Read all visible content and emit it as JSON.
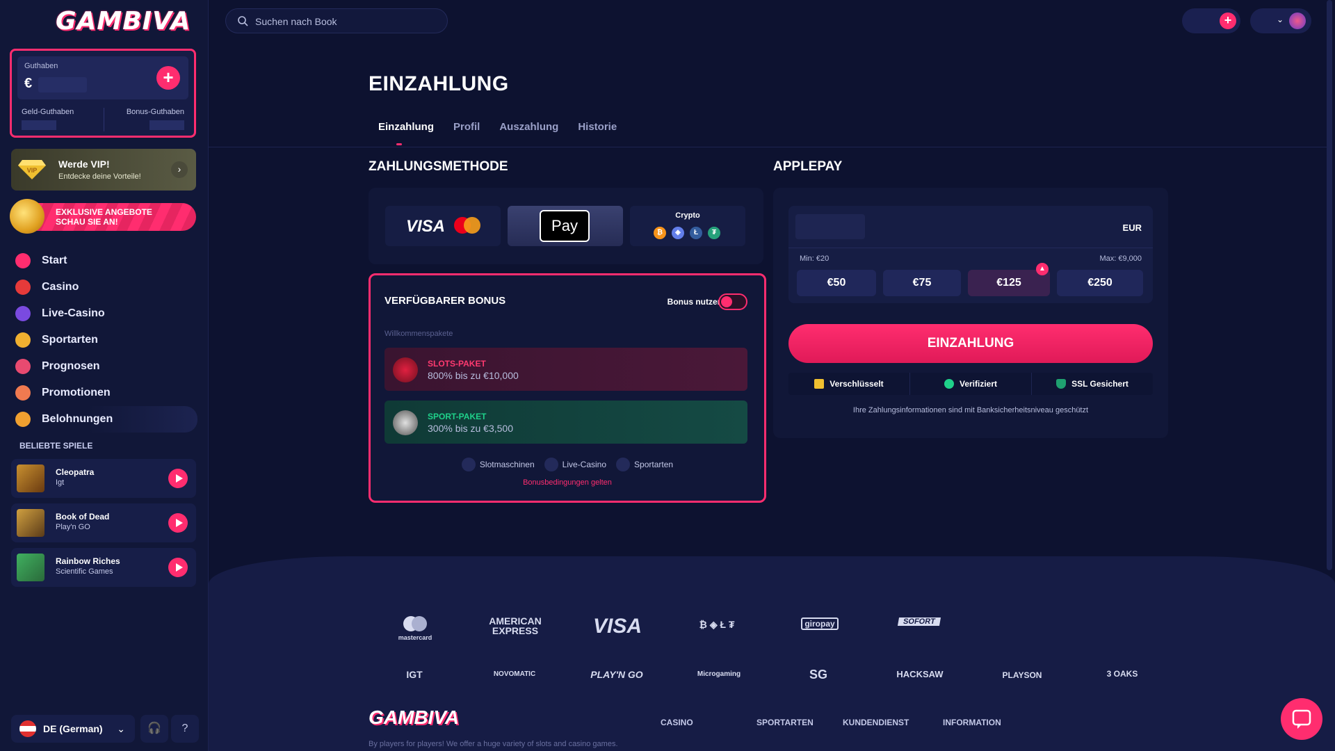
{
  "sidebar": {
    "logo": "GAMBIVA",
    "balance": {
      "label": "Guthaben",
      "currency": "€",
      "money_label": "Geld-Guthaben",
      "bonus_label": "Bonus-Guthaben"
    },
    "vip": {
      "title": "Werde VIP!",
      "subtitle": "Entdecke deine Vorteile!",
      "badge": "VIP"
    },
    "promo": {
      "line1": "EXKLUSIVE ANGEBOTE",
      "line2": "SCHAU SIE AN!"
    },
    "nav": [
      {
        "label": "Start",
        "icon": "swirl-icon",
        "color": "#ff2d6f"
      },
      {
        "label": "Casino",
        "icon": "cherry-icon",
        "color": "#e63a3a"
      },
      {
        "label": "Live-Casino",
        "icon": "chip-icon",
        "color": "#7a4ae0"
      },
      {
        "label": "Sportarten",
        "icon": "medal-icon",
        "color": "#f0b030"
      },
      {
        "label": "Prognosen",
        "icon": "trend-icon",
        "color": "#e84a70"
      },
      {
        "label": "Promotionen",
        "icon": "cupcake-icon",
        "color": "#f07a50"
      },
      {
        "label": "Belohnungen",
        "icon": "trophy-icon",
        "color": "#f0a030"
      }
    ],
    "popular_title": "BELIEBTE SPIELE",
    "games": [
      {
        "name": "Cleopatra",
        "provider": "Igt"
      },
      {
        "name": "Book of Dead",
        "provider": "Play'n GO"
      },
      {
        "name": "Rainbow Riches",
        "provider": "Scientific Games"
      }
    ],
    "language": "DE (German)"
  },
  "topbar": {
    "search_placeholder": "Suchen nach Book"
  },
  "main": {
    "title": "EINZAHLUNG",
    "tabs": [
      "Einzahlung",
      "Profil",
      "Auszahlung",
      "Historie"
    ],
    "method_title": "ZAHLUNGSMETHODE",
    "methods": {
      "visa": "VISA",
      "mastercard": "mastercard",
      "applepay": "Pay",
      "crypto": "Crypto"
    },
    "bonus": {
      "title": "VERFÜGBARER BONUS",
      "use_label": "Bonus nutzen",
      "subtitle": "Willkommenspakete",
      "packages": [
        {
          "name": "SLOTS-PAKET",
          "desc": "800% bis zu €10,000"
        },
        {
          "name": "SPORT-PAKET",
          "desc": "300% bis zu €3,500"
        }
      ],
      "tags": [
        "Slotmaschinen",
        "Live-Casino",
        "Sportarten"
      ],
      "terms": "Bonusbedingungen gelten"
    },
    "applepay": {
      "title": "APPLEPAY",
      "currency": "EUR",
      "min": "Min: €20",
      "max": "Max: €9,000",
      "amounts": [
        "€50",
        "€75",
        "€125",
        "€250"
      ],
      "deposit_label": "EINZAHLUNG",
      "security": [
        "Verschlüsselt",
        "Verifiziert",
        "SSL Gesichert"
      ],
      "note": "Ihre Zahlungsinformationen sind mit Banksicherheitsniveau geschützt"
    }
  },
  "footer": {
    "payments": [
      "mastercard",
      "AMERICAN EXPRESS",
      "VISA",
      "₿ ◈ Ł ₮",
      "giropay",
      "SOFORT"
    ],
    "providers": [
      "IGT",
      "NOVOMATIC",
      "PLAY'N GO",
      "Microgaming",
      "SG",
      "HACKSAW",
      "PLAYSON",
      "3 OAKS"
    ],
    "logo": "GAMBIVA",
    "columns": [
      "CASINO",
      "SPORTARTEN",
      "KUNDENDIENST",
      "INFORMATION"
    ],
    "tagline": "By players for players! We offer a huge variety of slots and casino games."
  },
  "colors": {
    "accent": "#ff2d6f",
    "background": "#0d1230",
    "panel": "#111738"
  }
}
